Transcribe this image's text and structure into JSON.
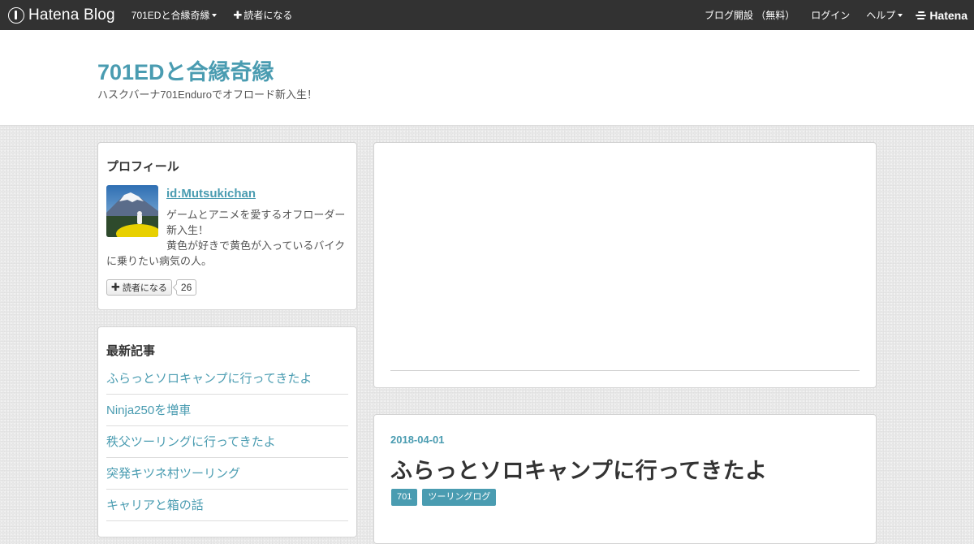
{
  "globalbar": {
    "logo_text": "Hatena Blog",
    "blog_menu_label": "701EDと合縁奇縁",
    "subscribe_label": "読者になる",
    "open_blog_label": "ブログ開設 （無料）",
    "login_label": "ログイン",
    "help_label": "ヘルプ",
    "hatena_label": "Hatena"
  },
  "header": {
    "blog_title": "701EDと合縁奇縁",
    "blog_description": "ハスクバーナ701Enduroでオフロード新入生！"
  },
  "profile": {
    "title": "プロフィール",
    "user_id": "id:Mutsukichan",
    "bio_line1": "ゲームとアニメを愛するオフローダー",
    "bio_line2": "新入生！",
    "bio_line3": "黄色が好きで黄色が入っているバイク",
    "bio_line4": "に乗りたい病気の人。",
    "subscribe_label": "読者になる",
    "subscriber_count": "26",
    "avatar_icon": "avatar-mount-fuji-photo"
  },
  "recent": {
    "title": "最新記事",
    "items": [
      {
        "label": "ふらっとソロキャンプに行ってきたよ"
      },
      {
        "label": "Ninja250を増車"
      },
      {
        "label": "秩父ツーリングに行ってきたよ"
      },
      {
        "label": "突発キツネ村ツーリング"
      },
      {
        "label": "キャリアと箱の話"
      }
    ]
  },
  "article": {
    "date": "2018-04-01",
    "title": "ふらっとソロキャンプに行ってきたよ",
    "categories": [
      {
        "label": "701"
      },
      {
        "label": "ツーリングログ"
      }
    ]
  },
  "colors": {
    "accent": "#4a9cb1",
    "globalbar_bg": "#323232",
    "text": "#333333"
  }
}
